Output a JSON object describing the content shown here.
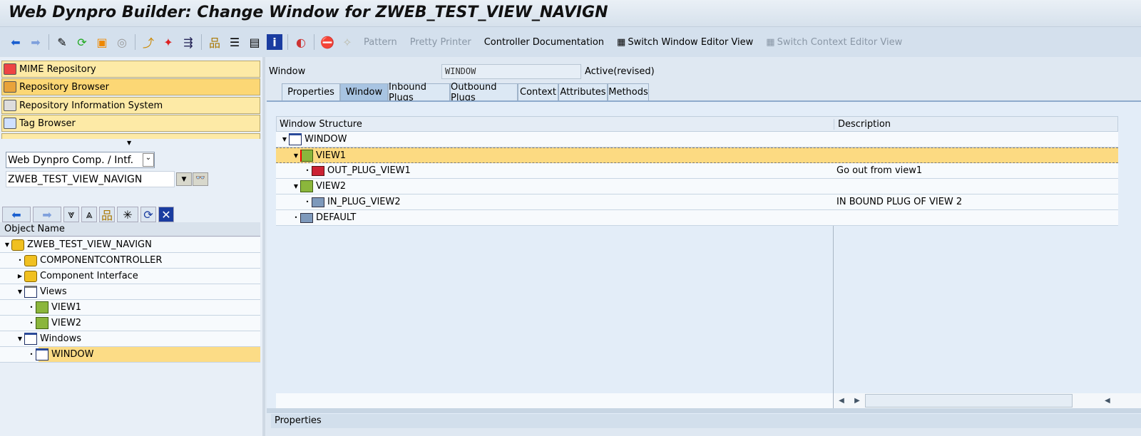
{
  "title": "Web Dynpro Builder: Change Window for ZWEB_TEST_VIEW_NAVIGN",
  "toolbar": {
    "pattern": "Pattern",
    "pretty_printer": "Pretty Printer",
    "controller_doc": "Controller Documentation",
    "switch_window": "Switch Window Editor View",
    "switch_context": "Switch Context Editor View"
  },
  "left": {
    "nav_buttons": [
      "MIME Repository",
      "Repository Browser",
      "Repository Information System",
      "Tag Browser"
    ],
    "object_type": "Web Dynpro Comp. / Intf.",
    "object_name": "ZWEB_TEST_VIEW_NAVIGN",
    "tree_header": "Object Name",
    "tree": [
      "ZWEB_TEST_VIEW_NAVIGN",
      "COMPONENTCONTROLLER",
      "Component Interface",
      "Views",
      "VIEW1",
      "VIEW2",
      "Windows",
      "WINDOW"
    ]
  },
  "right": {
    "window_label": "Window",
    "window_value": "WINDOW",
    "status": "Active(revised)",
    "tabs": [
      "Properties",
      "Window",
      "Inbound Plugs",
      "Outbound Plugs",
      "Context",
      "Attributes",
      "Methods"
    ],
    "columns": [
      "Window Structure",
      "Description"
    ],
    "rows": [
      {
        "name": "WINDOW",
        "desc": ""
      },
      {
        "name": "VIEW1",
        "desc": ""
      },
      {
        "name": "OUT_PLUG_VIEW1",
        "desc": "Go out from view1"
      },
      {
        "name": "VIEW2",
        "desc": ""
      },
      {
        "name": "IN_PLUG_VIEW2",
        "desc": "IN BOUND PLUG OF VIEW 2"
      },
      {
        "name": "DEFAULT",
        "desc": ""
      }
    ],
    "properties_label": "Properties"
  }
}
